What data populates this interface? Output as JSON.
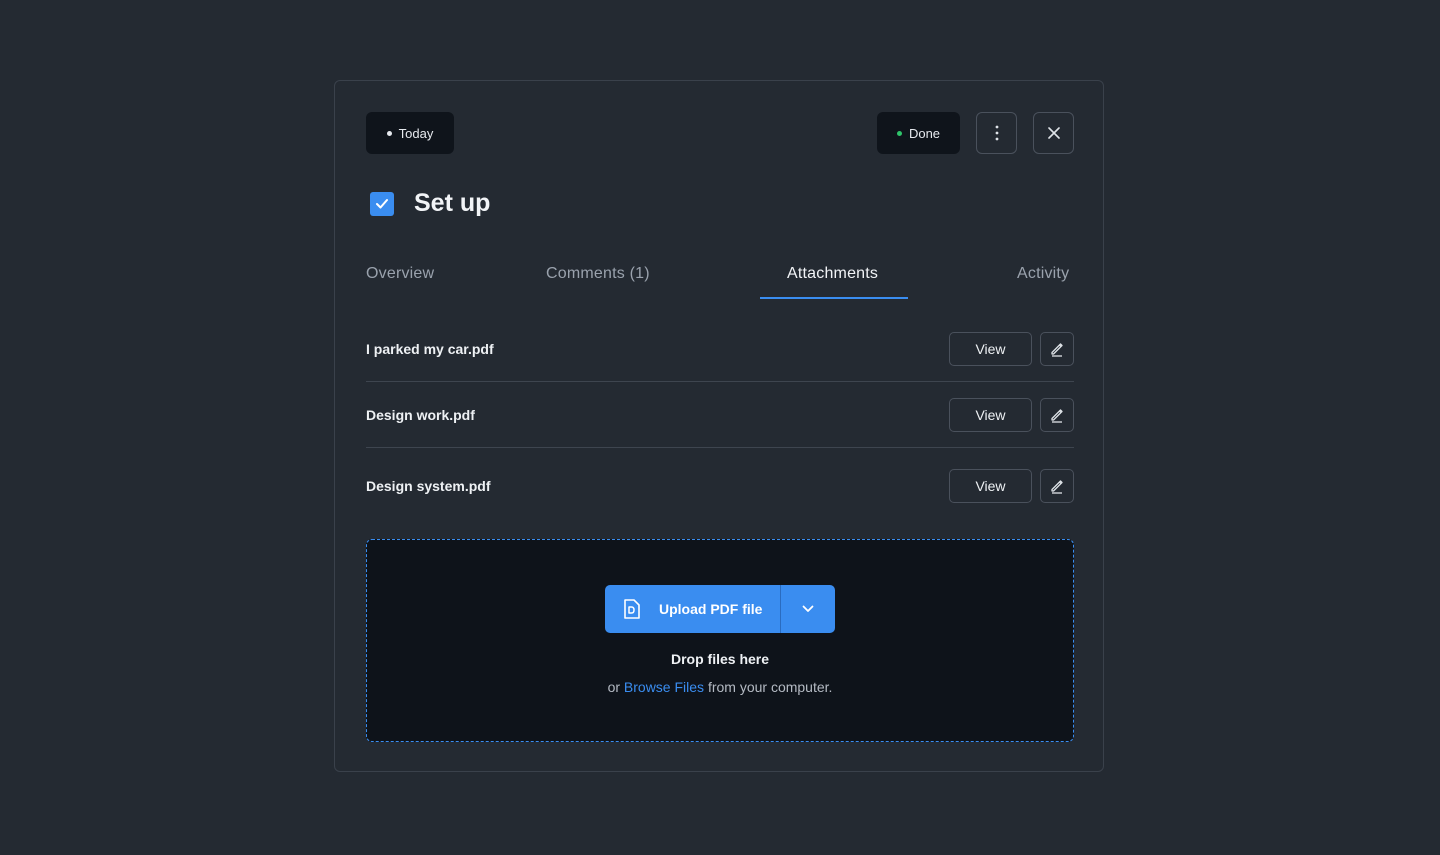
{
  "header": {
    "today_label": "Today",
    "status_label": "Done",
    "status_color": "#2fc46a",
    "today_dot_color": "#e6e9ee",
    "more_icon": "more-vertical-icon",
    "close_icon": "close-icon"
  },
  "task": {
    "title": "Set up",
    "checked": true
  },
  "tabs": [
    {
      "label": "Overview",
      "active": false
    },
    {
      "label": "Comments (1)",
      "active": false
    },
    {
      "label": "Attachments",
      "active": true
    },
    {
      "label": "Activity",
      "active": false
    }
  ],
  "attachments": [
    {
      "name": "I parked my car.pdf",
      "view_label": "View",
      "edit_icon": "pencil-icon"
    },
    {
      "name": "Design work.pdf",
      "view_label": "View",
      "edit_icon": "pencil-icon"
    },
    {
      "name": "Design system.pdf",
      "view_label": "View",
      "edit_icon": "pencil-icon"
    }
  ],
  "dropzone": {
    "upload_label": "Upload PDF file",
    "upload_icon": "pdf-file-icon",
    "caret_icon": "chevron-down-icon",
    "title": "Drop files here",
    "sub_prefix": "or",
    "sub_link": "Browse Files",
    "sub_suffix": "from your computer."
  },
  "colors": {
    "accent": "#3a8df0",
    "background": "#242a32",
    "dropzone_bg": "#0e131a"
  }
}
